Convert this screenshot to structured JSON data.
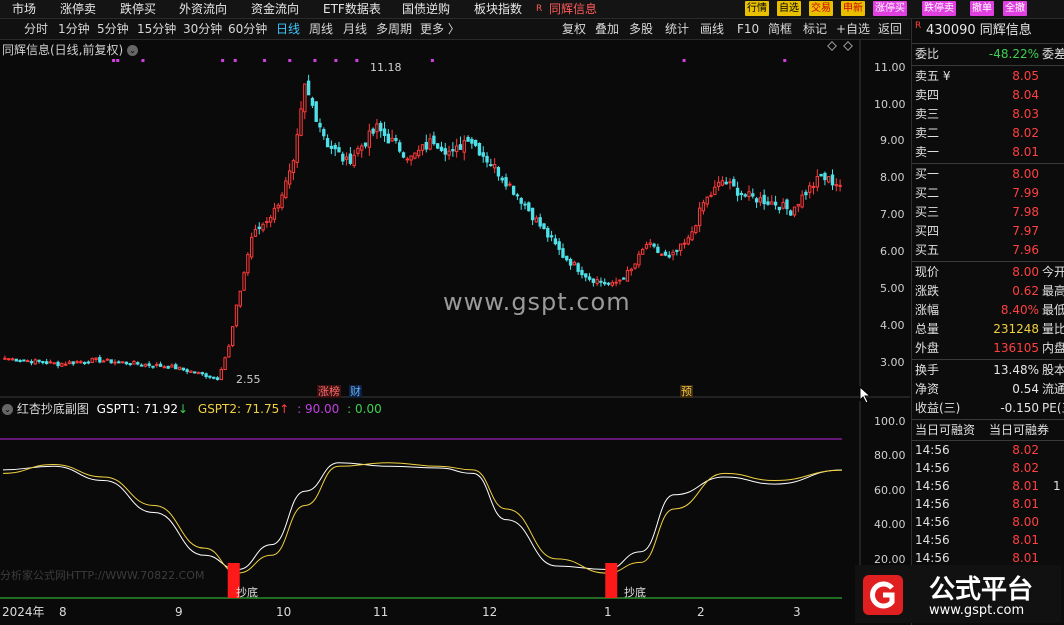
{
  "topnav": [
    {
      "label": "市场",
      "color": "white"
    },
    {
      "label": "涨停卖",
      "color": "white"
    },
    {
      "label": "跌停买",
      "color": "white"
    },
    {
      "label": "外资流向",
      "color": "white"
    },
    {
      "label": "资金流向",
      "color": "white"
    },
    {
      "label": "ETF数据表",
      "color": "white"
    },
    {
      "label": "国债逆购",
      "color": "white"
    },
    {
      "label": "板块指数",
      "color": "white"
    },
    {
      "label": "同辉信息",
      "color": "red"
    }
  ],
  "topnav_r_badge": "R",
  "top_buttons": [
    {
      "label": "行情",
      "bg": "#e8c000",
      "fg": "#000"
    },
    {
      "label": "自选",
      "bg": "#e8c000",
      "fg": "#000"
    },
    {
      "label": "交易",
      "bg": "#e8c000",
      "fg": "#d00000"
    },
    {
      "label": "申新",
      "bg": "#e8c000",
      "fg": "#d00000"
    },
    {
      "label": "涨停买",
      "bg": "#e040e0",
      "fg": "#fff"
    },
    {
      "label": "跌停卖",
      "bg": "#e040e0",
      "fg": "#fff"
    },
    {
      "label": "撤单",
      "bg": "#e040e0",
      "fg": "#fff"
    },
    {
      "label": "全撤",
      "bg": "#e040e0",
      "fg": "#fff"
    }
  ],
  "periods": [
    "分时",
    "1分钟",
    "5分钟",
    "15分钟",
    "30分钟",
    "60分钟",
    "日线",
    "周线",
    "月线",
    "多周期",
    "更多 〉"
  ],
  "active_period": "日线",
  "toolbar": [
    "复权",
    "叠加",
    "多股",
    "统计",
    "画线",
    "F10",
    "简框",
    "标记",
    "+自选",
    "返回"
  ],
  "chart_title": "同辉信息(日线,前复权)",
  "price_axis": [
    "11.00",
    "10.00",
    "9.00",
    "8.00",
    "7.00",
    "6.00",
    "5.00",
    "4.00",
    "3.00"
  ],
  "max_label": "11.18",
  "min_label": "2.55",
  "event_tags": [
    {
      "label": "涨榜",
      "color": "#ff6a6a",
      "bg": "#3a1010"
    },
    {
      "label": "财",
      "color": "#5ab0ff",
      "bg": "#10203a"
    },
    {
      "label": "预",
      "color": "#f0c040",
      "bg": "#3a2a10"
    }
  ],
  "indicator": {
    "name": "红杏抄底副图",
    "gspt1_label": "GSPT1: 71.92",
    "gspt2_label": "GSPT2: 71.75",
    "level_label": ": 90.00",
    "zero_label": ": 0.00",
    "axis": [
      "100.0",
      "80.00",
      "60.00",
      "40.00",
      "20.00"
    ],
    "signal_label": "抄底"
  },
  "date_axis": [
    "2024年",
    "8",
    "9",
    "10",
    "11",
    "12",
    "1",
    "2",
    "3"
  ],
  "watermark": "www.gspt.com",
  "watermark_bottom": "分析家公式网HTTP://WWW.70822.COM",
  "quote": {
    "r_badge": "R",
    "code_name": "430090 同辉信息",
    "weibi_label": "委比",
    "weibi_value": "-48.22%",
    "weicha_label": "委差",
    "asks": [
      {
        "label": "卖五 ¥",
        "price": "8.05"
      },
      {
        "label": "卖四",
        "price": "8.04"
      },
      {
        "label": "卖三",
        "price": "8.03"
      },
      {
        "label": "卖二",
        "price": "8.02"
      },
      {
        "label": "卖一",
        "price": "8.01"
      }
    ],
    "bids": [
      {
        "label": "买一",
        "price": "8.00"
      },
      {
        "label": "买二",
        "price": "7.99"
      },
      {
        "label": "买三",
        "price": "7.98"
      },
      {
        "label": "买四",
        "price": "7.97"
      },
      {
        "label": "买五",
        "price": "7.96"
      }
    ],
    "stats1": [
      {
        "label": "现价",
        "value": "8.00",
        "color": "red",
        "extra": "今开"
      },
      {
        "label": "涨跌",
        "value": "0.62",
        "color": "red",
        "extra": "最高"
      },
      {
        "label": "涨幅",
        "value": "8.40%",
        "color": "red",
        "extra": "最低"
      },
      {
        "label": "总量",
        "value": "231248",
        "color": "yellow",
        "extra": "量比"
      },
      {
        "label": "外盘",
        "value": "136105",
        "color": "red",
        "extra": "内盘"
      }
    ],
    "stats2": [
      {
        "label": "换手",
        "value": "13.48%",
        "color": "white",
        "extra": "股本"
      },
      {
        "label": "净资",
        "value": "0.54",
        "color": "white",
        "extra": "流通"
      },
      {
        "label": "收益(三)",
        "value": "-0.150",
        "color": "white",
        "extra": "PE(三"
      }
    ],
    "margin_head": [
      "当日可融资",
      "当日可融券"
    ],
    "ticks": [
      {
        "time": "14:56",
        "price": "8.02",
        "color": "red"
      },
      {
        "time": "14:56",
        "price": "8.02",
        "color": "red"
      },
      {
        "time": "14:56",
        "price": "8.01",
        "color": "red"
      },
      {
        "time": "14:56",
        "price": "8.01",
        "color": "red"
      },
      {
        "time": "14:56",
        "price": "8.00",
        "color": "red"
      },
      {
        "time": "14:56",
        "price": "8.01",
        "color": "red"
      },
      {
        "time": "14:56",
        "price": "8.01",
        "color": "red"
      }
    ]
  },
  "brand": {
    "name": "公式平台",
    "url": "www.gspt.com"
  },
  "chart_data": {
    "type": "candlestick",
    "price_range": [
      2.4,
      11.5
    ],
    "segments": [
      [
        3.25,
        0
      ],
      [
        3.1,
        14
      ],
      [
        3.2,
        10
      ],
      [
        3.02,
        20
      ],
      [
        2.72,
        12
      ],
      [
        3.55,
        3
      ],
      [
        4.6,
        2
      ],
      [
        6.5,
        4
      ],
      [
        7.2,
        6
      ],
      [
        8.4,
        5
      ],
      [
        10.5,
        3
      ],
      [
        9.0,
        6
      ],
      [
        8.5,
        5
      ],
      [
        9.4,
        8
      ],
      [
        8.6,
        9
      ],
      [
        9.1,
        6
      ],
      [
        8.7,
        5
      ],
      [
        9.2,
        4
      ],
      [
        8.7,
        4
      ],
      [
        8.0,
        6
      ],
      [
        7.5,
        4
      ],
      [
        6.8,
        5
      ],
      [
        6.0,
        6
      ],
      [
        5.4,
        7
      ],
      [
        5.2,
        6
      ],
      [
        5.6,
        5
      ],
      [
        6.3,
        4
      ],
      [
        5.9,
        6
      ],
      [
        6.4,
        5
      ],
      [
        7.4,
        4
      ],
      [
        8.0,
        5
      ],
      [
        7.6,
        6
      ],
      [
        7.4,
        8
      ],
      [
        7.2,
        4
      ],
      [
        7.7,
        4
      ],
      [
        8.1,
        4
      ],
      [
        7.9,
        5
      ]
    ],
    "oscillator_range": [
      0,
      100
    ],
    "gspt1_points": [
      [
        0,
        72
      ],
      [
        0.06,
        74
      ],
      [
        0.12,
        66
      ],
      [
        0.18,
        48
      ],
      [
        0.24,
        24
      ],
      [
        0.28,
        16
      ],
      [
        0.32,
        30
      ],
      [
        0.36,
        60
      ],
      [
        0.4,
        76
      ],
      [
        0.46,
        74
      ],
      [
        0.52,
        73
      ],
      [
        0.56,
        70
      ],
      [
        0.6,
        44
      ],
      [
        0.66,
        18
      ],
      [
        0.72,
        16
      ],
      [
        0.76,
        26
      ],
      [
        0.8,
        58
      ],
      [
        0.86,
        68
      ],
      [
        0.92,
        64
      ],
      [
        1.0,
        71.92
      ]
    ],
    "gspt2_points": [
      [
        0,
        70
      ],
      [
        0.06,
        75
      ],
      [
        0.12,
        68
      ],
      [
        0.18,
        52
      ],
      [
        0.24,
        28
      ],
      [
        0.28,
        14
      ],
      [
        0.32,
        24
      ],
      [
        0.36,
        52
      ],
      [
        0.4,
        74
      ],
      [
        0.46,
        76
      ],
      [
        0.52,
        74
      ],
      [
        0.56,
        72
      ],
      [
        0.6,
        50
      ],
      [
        0.66,
        22
      ],
      [
        0.72,
        14
      ],
      [
        0.76,
        20
      ],
      [
        0.8,
        50
      ],
      [
        0.86,
        70
      ],
      [
        0.92,
        66
      ],
      [
        1.0,
        71.75
      ]
    ],
    "level_90": 90,
    "signals": [
      0.275,
      0.725
    ]
  }
}
